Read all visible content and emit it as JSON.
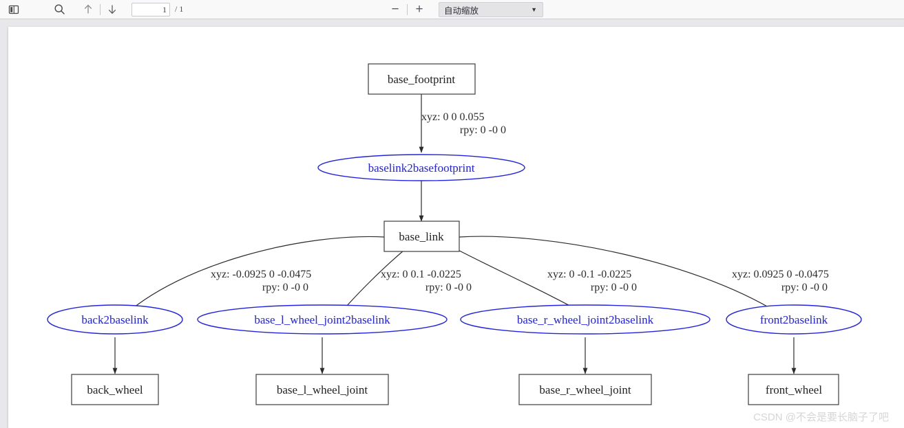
{
  "toolbar": {
    "sidebar_toggle_icon": "sidebar-toggle-icon",
    "find_icon": "search-icon",
    "prev_page_icon": "arrow-up-icon",
    "next_page_icon": "arrow-down-icon",
    "page_number_value": "1",
    "page_count_label": "/ 1",
    "zoom_out_label": "−",
    "zoom_in_label": "+",
    "zoom_select_value": "自动缩放",
    "zoom_caret_icon": "chevron-down-icon"
  },
  "watermark": {
    "text": "CSDN @不会是要长脑子了吧"
  },
  "graph": {
    "colors": {
      "link_node_stroke": "#3c3c3c",
      "link_node_text": "#222222",
      "joint_node_stroke": "#2222e0",
      "joint_node_text": "#2222e0",
      "edge": "#2b2b2b"
    },
    "link_nodes": [
      {
        "id": "base_footprint",
        "label": "base_footprint"
      },
      {
        "id": "base_link",
        "label": "base_link"
      },
      {
        "id": "back_wheel",
        "label": "back_wheel"
      },
      {
        "id": "base_l_wheel_joint",
        "label": "base_l_wheel_joint"
      },
      {
        "id": "base_r_wheel_joint",
        "label": "base_r_wheel_joint"
      },
      {
        "id": "front_wheel",
        "label": "front_wheel"
      }
    ],
    "joint_nodes": [
      {
        "id": "baselink2basefootprint",
        "label": "baselink2basefootprint"
      },
      {
        "id": "back2baselink",
        "label": "back2baselink"
      },
      {
        "id": "base_l_wheel_joint2baselink",
        "label": "base_l_wheel_joint2baselink"
      },
      {
        "id": "base_r_wheel_joint2baselink",
        "label": "base_r_wheel_joint2baselink"
      },
      {
        "id": "front2baselink",
        "label": "front2baselink"
      }
    ],
    "edge_labels": [
      {
        "id": "e_basefootprint_to_baselink2basefootprint",
        "xyz": "xyz: 0 0 0.055",
        "rpy": "rpy: 0 -0 0"
      },
      {
        "id": "e_baselink_to_back2baselink",
        "xyz": "xyz: -0.0925 0 -0.0475",
        "rpy": "rpy: 0 -0 0"
      },
      {
        "id": "e_baselink_to_base_l_wheel_joint2baselink",
        "xyz": "xyz: 0 0.1 -0.0225",
        "rpy": "rpy: 0 -0 0"
      },
      {
        "id": "e_baselink_to_base_r_wheel_joint2baselink",
        "xyz": "xyz: 0 -0.1 -0.0225",
        "rpy": "rpy: 0 -0 0"
      },
      {
        "id": "e_baselink_to_front2baselink",
        "xyz": "xyz: 0.0925 0 -0.0475",
        "rpy": "rpy: 0 -0 0"
      }
    ]
  }
}
